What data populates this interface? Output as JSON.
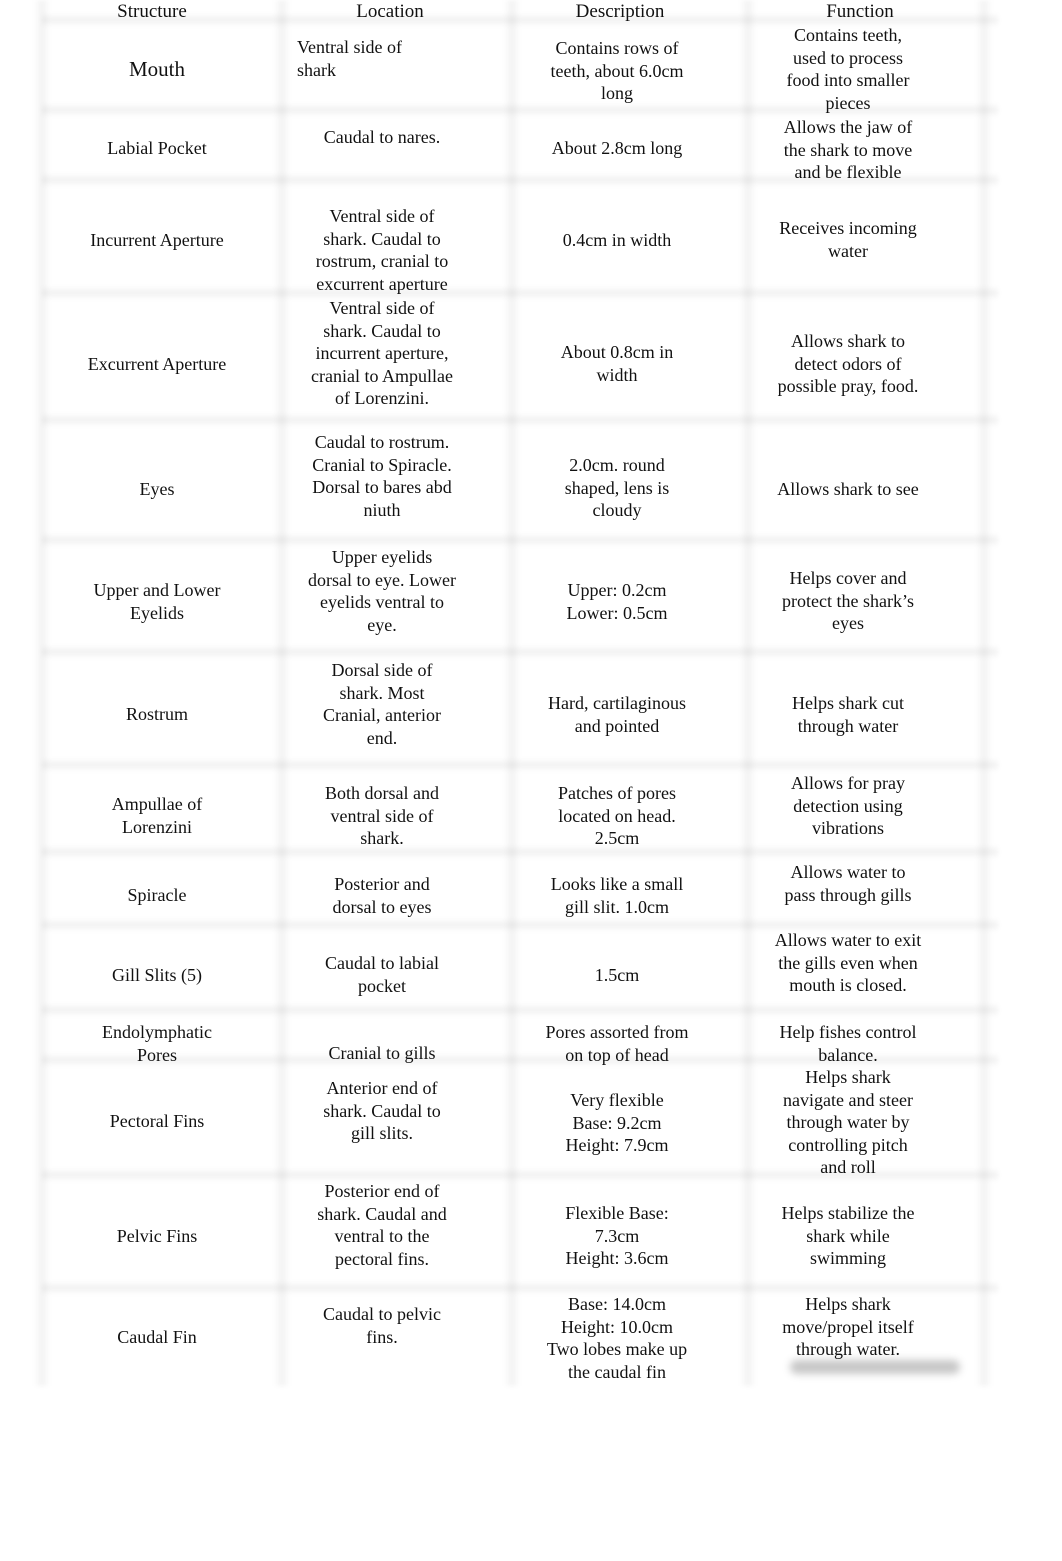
{
  "table": {
    "headers": [
      "Structure",
      "Location",
      "Description",
      "Function"
    ],
    "rows": [
      {
        "structure": [
          "Mouth"
        ],
        "location": [
          "Ventral side of",
          "shark"
        ],
        "description": [
          "Contains rows of",
          "teeth, about 6.0cm",
          "long"
        ],
        "function": [
          "Contains teeth,",
          "used to process",
          "food into smaller",
          "pieces"
        ]
      },
      {
        "structure": [
          "Labial Pocket"
        ],
        "location": [
          "Caudal to nares."
        ],
        "description": [
          "About 2.8cm long"
        ],
        "function": [
          "Allows the jaw of",
          "the shark to move",
          "and be flexible"
        ]
      },
      {
        "structure": [
          "Incurrent Aperture"
        ],
        "location": [
          "Ventral side of",
          "shark. Caudal to",
          "rostrum, cranial to",
          "excurrent aperture"
        ],
        "description": [
          "0.4cm in width"
        ],
        "function": [
          "Receives incoming",
          "water"
        ]
      },
      {
        "structure": [
          "Excurrent Aperture"
        ],
        "location": [
          "Ventral side of",
          "shark. Caudal to",
          "incurrent aperture,",
          "cranial to Ampullae",
          "of Lorenzini."
        ],
        "description": [
          "About 0.8cm in",
          "width"
        ],
        "function": [
          "Allows shark to",
          "detect odors of",
          "possible pray, food."
        ]
      },
      {
        "structure": [
          "Eyes"
        ],
        "location": [
          "Caudal to rostrum.",
          "Cranial to Spiracle.",
          "Dorsal to bares abd",
          "niuth"
        ],
        "description": [
          "2.0cm. round",
          "shaped, lens is",
          "cloudy"
        ],
        "function": [
          "Allows shark to see"
        ]
      },
      {
        "structure": [
          "Upper and Lower",
          "Eyelids"
        ],
        "location": [
          "Upper eyelids",
          "dorsal to eye. Lower",
          "eyelids ventral to",
          "eye."
        ],
        "description": [
          "Upper: 0.2cm",
          "Lower: 0.5cm"
        ],
        "function": [
          "Helps cover and",
          "protect the shark’s",
          "eyes"
        ]
      },
      {
        "structure": [
          "Rostrum"
        ],
        "location": [
          "Dorsal side of",
          "shark. Most",
          "Cranial, anterior",
          "end."
        ],
        "description": [
          "Hard, cartilaginous",
          "and pointed"
        ],
        "function": [
          "Helps shark cut",
          "through water"
        ]
      },
      {
        "structure": [
          "Ampullae of",
          "Lorenzini"
        ],
        "location": [
          "Both dorsal and",
          "ventral side of",
          "shark."
        ],
        "description": [
          "Patches of pores",
          "located on head.",
          "2.5cm"
        ],
        "function": [
          "Allows for pray",
          "detection using",
          "vibrations"
        ]
      },
      {
        "structure": [
          "Spiracle"
        ],
        "location": [
          "Posterior and",
          "dorsal to eyes"
        ],
        "description": [
          "Looks like a small",
          "gill slit. 1.0cm"
        ],
        "function": [
          "Allows water to",
          "pass through gills"
        ]
      },
      {
        "structure": [
          "Gill Slits (5)"
        ],
        "location": [
          "Caudal to labial",
          "pocket"
        ],
        "description": [
          "1.5cm"
        ],
        "function": [
          "Allows water to exit",
          "the gills even when",
          "mouth is closed."
        ]
      },
      {
        "structure": [
          "Endolymphatic",
          "Pores"
        ],
        "location": [
          "Cranial to gills"
        ],
        "description": [
          "Pores assorted from",
          "on top of head"
        ],
        "function": [
          "Help fishes control",
          "balance."
        ]
      },
      {
        "structure": [
          "Pectoral Fins"
        ],
        "location": [
          "Anterior end of",
          "shark. Caudal to",
          "gill slits."
        ],
        "description": [
          "Very flexible",
          "Base: 9.2cm",
          "Height: 7.9cm"
        ],
        "function": [
          "Helps shark",
          "navigate and steer",
          "through water by",
          "controlling pitch",
          "and roll"
        ]
      },
      {
        "structure": [
          "Pelvic Fins"
        ],
        "location": [
          "Posterior end of",
          "shark. Caudal and",
          "ventral to the",
          "pectoral fins."
        ],
        "description": [
          "Flexible Base:",
          "7.3cm",
          "Height: 3.6cm"
        ],
        "function": [
          "Helps stabilize the",
          "shark while",
          "swimming"
        ]
      },
      {
        "structure": [
          "Caudal Fin"
        ],
        "location": [
          "Caudal to pelvic",
          "fins."
        ],
        "description": [
          "Base: 14.0cm",
          "Height: 10.0cm",
          "Two lobes make up",
          "the caudal fin"
        ],
        "function": [
          "Helps shark",
          "move/propel itself",
          "through water."
        ]
      }
    ]
  }
}
